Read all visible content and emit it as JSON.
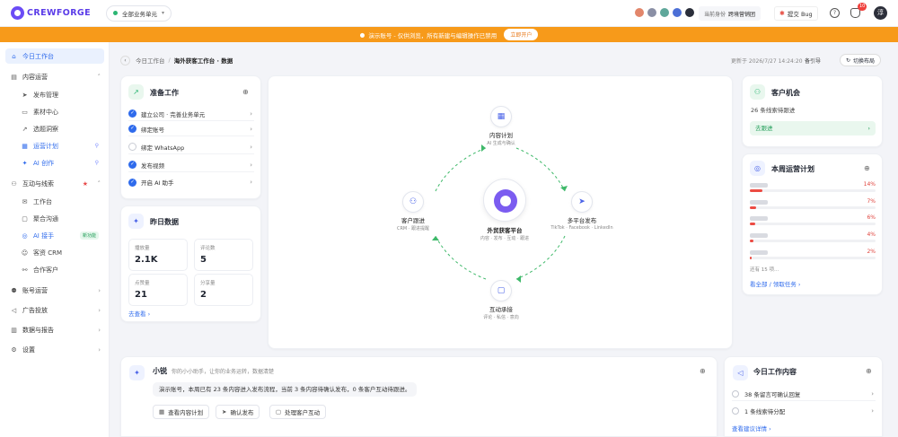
{
  "topbar": {
    "logo_text": "CREWFORGE",
    "unit_select": "全部业务单元",
    "identity_label": "当前身份",
    "identity_value": "跨境营销团",
    "bug_label": "提交 Bug",
    "notif_count": "10",
    "user_initial": "淳"
  },
  "banner": {
    "text": "演示账号 - 仅供浏览，所有新建与编辑操作已禁用",
    "button": "立即开户"
  },
  "sidebar": {
    "items": [
      {
        "label": "今日工作台"
      },
      {
        "label": "内容运营"
      },
      {
        "label": "发布管理"
      },
      {
        "label": "素材中心"
      },
      {
        "label": "选题洞察"
      },
      {
        "label": "运营计划"
      },
      {
        "label": "AI 创作"
      },
      {
        "label": "互动与线索"
      },
      {
        "label": "工作台"
      },
      {
        "label": "聚合沟通"
      },
      {
        "label": "AI 接手",
        "tag": "新功能"
      },
      {
        "label": "客资 CRM"
      },
      {
        "label": "合作客户"
      },
      {
        "label": "账号运营"
      },
      {
        "label": "广告投放"
      },
      {
        "label": "数据与报告"
      },
      {
        "label": "设置"
      }
    ]
  },
  "breadcrumb": {
    "home": "今日工作台",
    "current": "海外获客工作台 · 数据"
  },
  "header": {
    "updated": "更新于 2026/7/27 14:24:20",
    "hint": "备引导",
    "layout_button": "切换布局"
  },
  "prep": {
    "title": "准备工作",
    "tasks": [
      {
        "label": "建立公司 · 完善业务单元",
        "done": true
      },
      {
        "label": "绑定账号",
        "done": true
      },
      {
        "label": "绑定 WhatsApp",
        "done": false
      },
      {
        "label": "发布视频",
        "done": true
      },
      {
        "label": "开启 AI 助手",
        "done": true
      }
    ]
  },
  "yesterday": {
    "title": "昨日数据",
    "stats": [
      {
        "label": "播放量",
        "value": "2.1K"
      },
      {
        "label": "评论数",
        "value": "5"
      },
      {
        "label": "点赞量",
        "value": "21"
      },
      {
        "label": "分享量",
        "value": "2"
      }
    ],
    "link": "去查看"
  },
  "hub": {
    "center_name": "外贸获客平台",
    "center_sub": "内容 · 发布 · 互动 · 跟进",
    "nodes": [
      {
        "name": "内容计划",
        "sub": "AI 生成与确认"
      },
      {
        "name": "多平台发布",
        "sub": "TikTok · Facebook · LinkedIn"
      },
      {
        "name": "互动承接",
        "sub": "评论 · 私信 · 意向"
      },
      {
        "name": "客户跟进",
        "sub": "CRM · 跟进提醒"
      }
    ]
  },
  "opportunity": {
    "title": "客户机会",
    "text": "26 条线索待跟进",
    "button": "去跟进"
  },
  "weekly": {
    "title": "本周运营计划",
    "rows": [
      {
        "value": 14,
        "label": "14%"
      },
      {
        "value": 7,
        "label": "7%"
      },
      {
        "value": 6,
        "label": "6%"
      },
      {
        "value": 4,
        "label": "4%"
      },
      {
        "value": 2,
        "label": "2%"
      }
    ],
    "more": "还有 15 项...",
    "link": "看全部 / 领取任务"
  },
  "assistant": {
    "name": "小锐",
    "subtitle": "你的小小助手，让你的业务运转，数据清楚",
    "message": "演示账号，本周已有 23 条内容进入发布流程，当前 3 条内容待确认发布，0 条客户互动待跟进。",
    "actions": [
      "查看内容计划",
      "确认发布",
      "处理客户互动"
    ]
  },
  "today": {
    "title": "今日工作内容",
    "items": [
      "38 条留言可确认回复",
      "1 条线索待分配"
    ],
    "link": "查看建议详情"
  }
}
